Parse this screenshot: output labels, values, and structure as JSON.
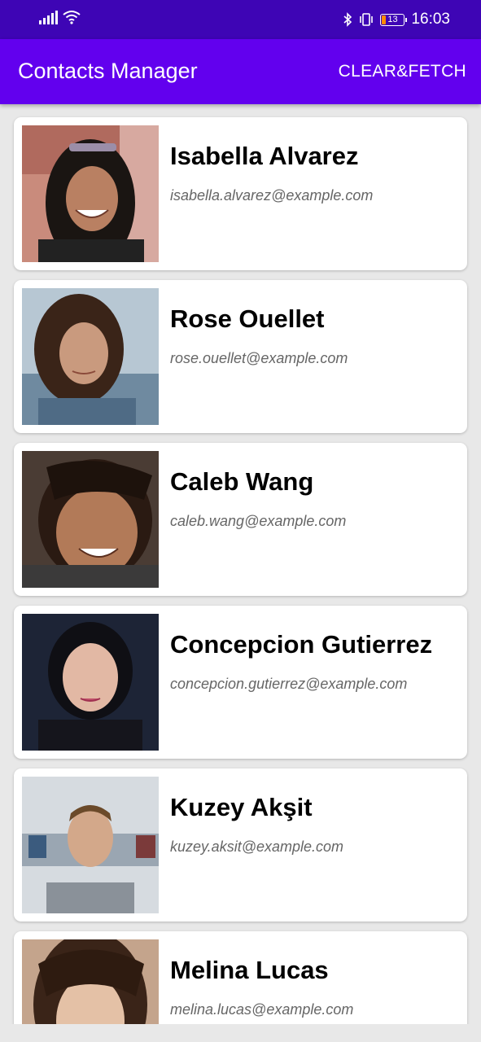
{
  "status_bar": {
    "time": "16:03",
    "battery_level": "13",
    "icons": [
      "signal-icon",
      "wifi-icon",
      "bluetooth-icon",
      "vibrate-icon",
      "battery-icon"
    ]
  },
  "app_bar": {
    "title": "Contacts Manager",
    "action_label": "CLEAR&FETCH",
    "color": "#6200ee",
    "status_color": "#3e05b5"
  },
  "contacts": [
    {
      "name": "Isabella Alvarez",
      "email": "isabella.alvarez@example.com"
    },
    {
      "name": "Rose Ouellet",
      "email": "rose.ouellet@example.com"
    },
    {
      "name": "Caleb Wang",
      "email": "caleb.wang@example.com"
    },
    {
      "name": "Concepcion Gutierrez",
      "email": "concepcion.gutierrez@example.com"
    },
    {
      "name": "Kuzey Akşit",
      "email": "kuzey.aksit@example.com"
    },
    {
      "name": "Melina Lucas",
      "email": "melina.lucas@example.com"
    }
  ]
}
